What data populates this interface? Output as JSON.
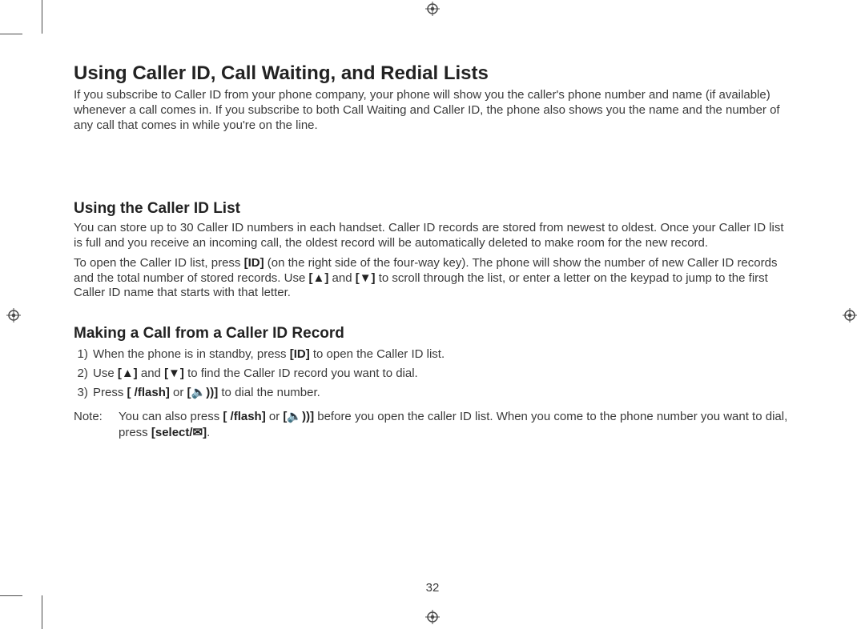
{
  "heading": "Using Caller ID, Call Waiting, and Redial Lists",
  "intro": "If you subscribe to Caller ID from your phone company, your phone will show you the caller's phone number and name (if available) whenever a call comes in. If you subscribe to both Call Waiting and Caller ID, the phone also shows you the name and the number of any call that comes in while you're on the line.",
  "sec1_title": "Using the Caller ID List",
  "sec1_p1": "You can store up to 30 Caller ID numbers in each handset. Caller ID records are stored from newest to oldest. Once your Caller ID list is full and you receive an incoming call, the oldest record will be automatically deleted to make room for the new record.",
  "sec1_p2_a": "To open the Caller ID list, press ",
  "sec1_p2_b": " (on the right side of the four-way key). The phone will show the number of new Caller ID records and the total number of stored records. Use ",
  "sec1_p2_c": " and ",
  "sec1_p2_d": "  to scroll through the list, or enter a letter on the keypad to jump to the first Caller ID name that starts with that letter.",
  "sec2_title": "Making a Call from a Caller ID Record",
  "step1_a": "When the phone is in standby, press ",
  "step1_b": " to open the Caller ID list.",
  "step2_a": "Use ",
  "step2_b": " and ",
  "step2_c": " to find the Caller ID record you want to dial.",
  "step3_a": "Press ",
  "step3_b": " or ",
  "step3_c": " to dial the number.",
  "note_label": "Note:",
  "note_a": "You can also press ",
  "note_b": " or ",
  "note_c": " before you open the caller ID list. When you come to the phone number you want to dial, press ",
  "note_d": ".",
  "btn_flash": "[ /flash]",
  "btn_select": "[select/✉]",
  "icon_id": "[ID]",
  "icon_up": "[▲]",
  "icon_down": "[▼]",
  "icon_speaker": "[🔈))]",
  "page_number": "32"
}
